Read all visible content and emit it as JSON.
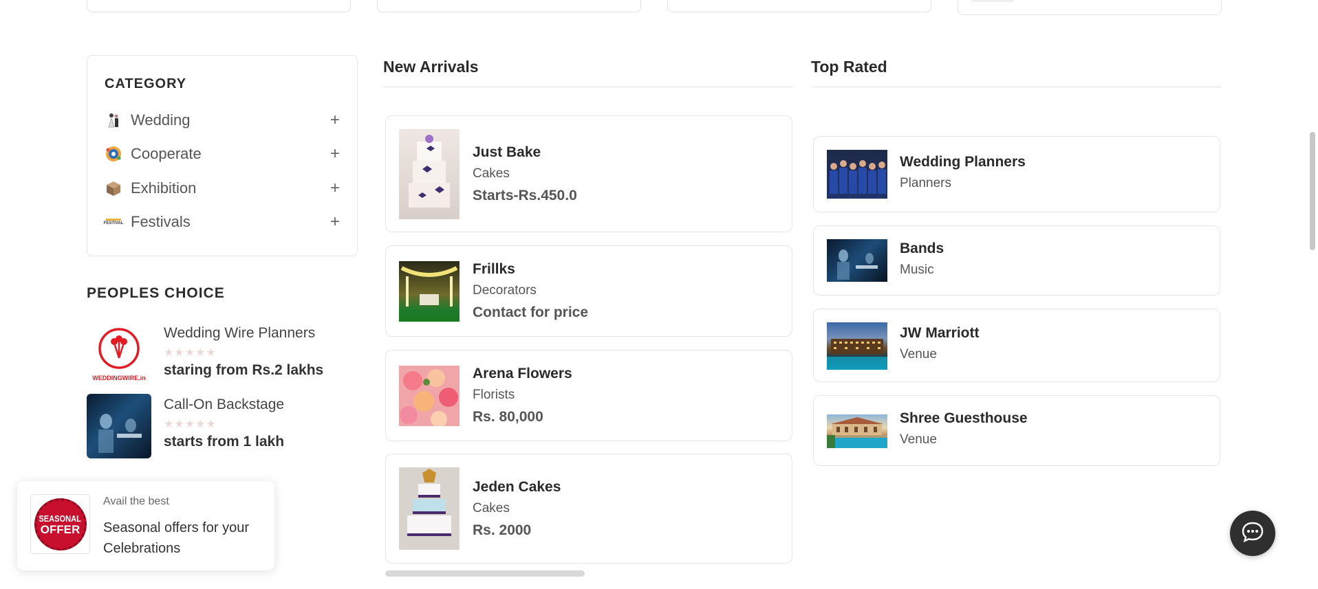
{
  "sidebar": {
    "category_title": "CATEGORY",
    "categories": [
      {
        "label": "Wedding",
        "icon": "wedding-couple-icon",
        "toggle": "+"
      },
      {
        "label": "Cooperate",
        "icon": "cooperate-icon",
        "toggle": "+"
      },
      {
        "label": "Exhibition",
        "icon": "exhibition-box-icon",
        "toggle": "+"
      },
      {
        "label": "Festivals",
        "icon": "festival-icon",
        "icon_text": "FESTIVAL",
        "toggle": "+"
      }
    ],
    "peoples_choice_title": "PEOPLES CHOICE",
    "peoples_choice": [
      {
        "name": "Wedding Wire Planners",
        "stars": "★★★★★",
        "price": "staring from Rs.2 lakhs",
        "logo_text": "WEDDINGWIRE.in"
      },
      {
        "name": "Call-On Backstage",
        "stars": "★★★★★",
        "price": "starts from 1 lakh"
      }
    ]
  },
  "new_arrivals": {
    "title": "New Arrivals",
    "items": [
      {
        "name": "Just Bake",
        "category": "Cakes",
        "price": "Starts-Rs.450.0"
      },
      {
        "name": "Frillks",
        "category": "Decorators",
        "price": "Contact for price"
      },
      {
        "name": "Arena Flowers",
        "category": "Florists",
        "price": "Rs. 80,000"
      },
      {
        "name": "Jeden Cakes",
        "category": "Cakes",
        "price": "Rs. 2000"
      }
    ]
  },
  "top_rated": {
    "title": "Top Rated",
    "items": [
      {
        "name": "Wedding Planners",
        "category": "Planners"
      },
      {
        "name": "Bands",
        "category": "Music"
      },
      {
        "name": "JW Marriott",
        "category": "Venue"
      },
      {
        "name": "Shree Guesthouse",
        "category": "Venue"
      }
    ]
  },
  "promo": {
    "badge_line1": "SEASONAL",
    "badge_line2": "OFFER",
    "small_text": "Avail the best",
    "big_text": "Seasonal offers for your Celebrations"
  },
  "chat": {
    "icon": "chat-bubble-icon"
  },
  "colors": {
    "brand_red": "#e31b23",
    "badge_red": "#c8102e",
    "chat_bg": "#2f2f2f"
  }
}
